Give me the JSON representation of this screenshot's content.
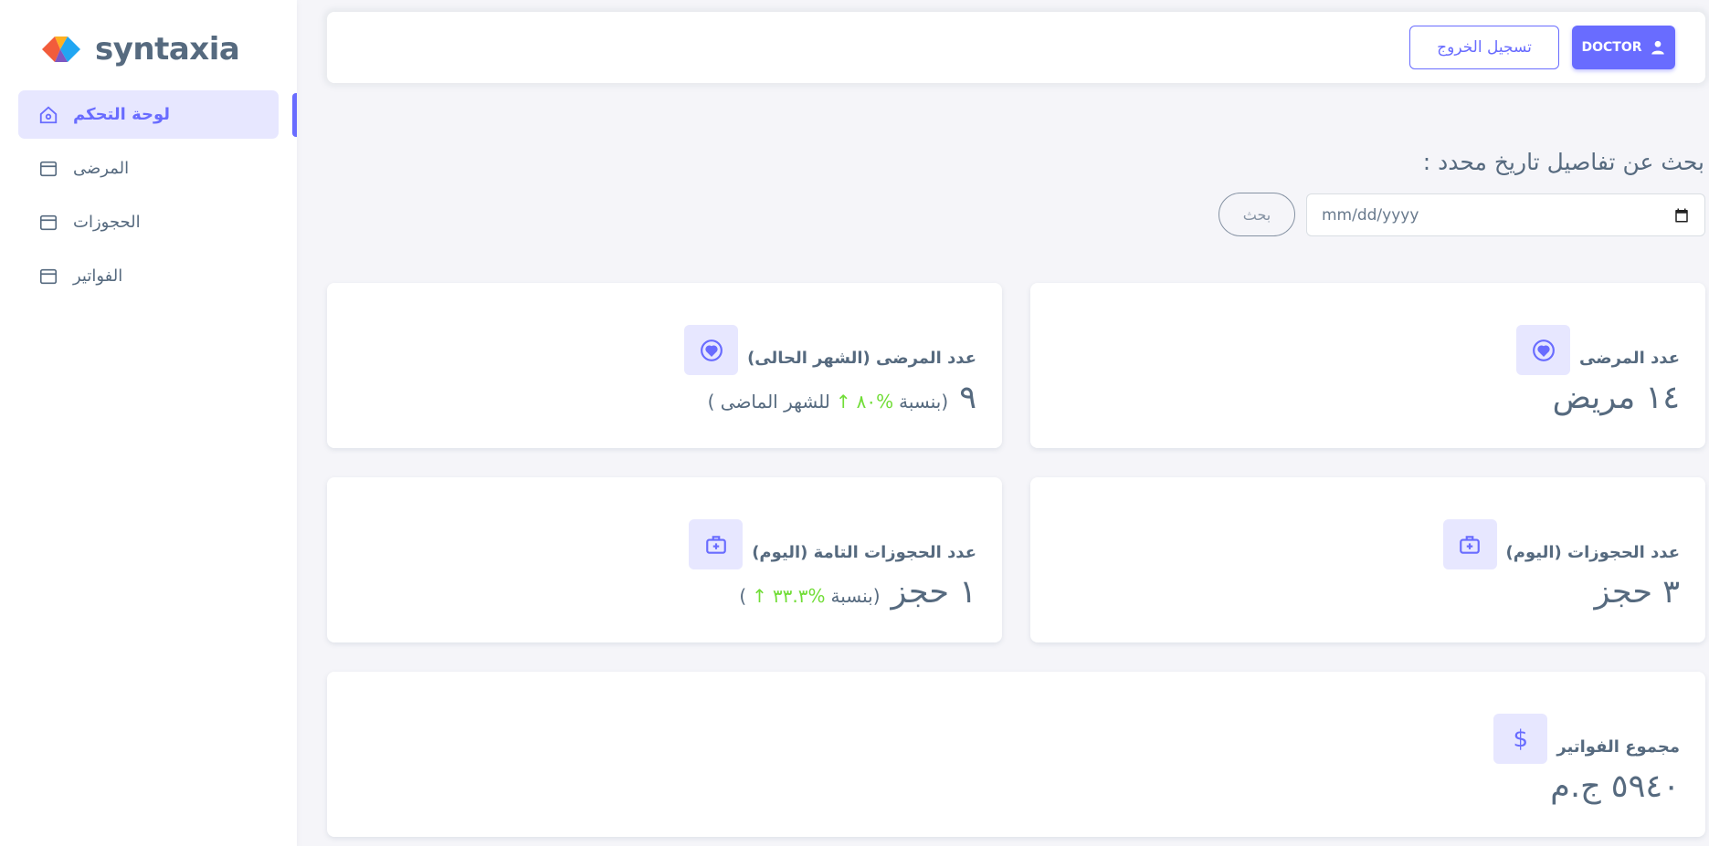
{
  "sidebar": {
    "brand": "syntaxia",
    "items": [
      {
        "label": "لوحة التحكم",
        "icon": "home-icon",
        "active": true
      },
      {
        "label": "المرضى",
        "icon": "layout-icon",
        "active": false
      },
      {
        "label": "الحجوزات",
        "icon": "layout-icon",
        "active": false
      },
      {
        "label": "الفواتير",
        "icon": "layout-icon",
        "active": false
      }
    ]
  },
  "navbar": {
    "role_button": "DOCTOR",
    "logout_button": "تسجيل الخروج"
  },
  "search": {
    "title": "بحث عن تفاصيل تاريخ محدد :",
    "date_placeholder": "mm/dd/yyyy",
    "button": "بحث"
  },
  "cards": {
    "patients_total": {
      "label": "عدد المرضى",
      "value": "١٤ مريض",
      "icon": "heart-icon"
    },
    "patients_month": {
      "label": "عدد المرضى (الشهر الحالى)",
      "value": "٩",
      "pre": "(بنسبة",
      "percent": "%٨٠",
      "arrow": "↑",
      "post": "للشهر الماضى )",
      "icon": "heart-icon"
    },
    "bookings_today": {
      "label": "عدد الحجوزات (اليوم)",
      "value": "٣ حجز",
      "icon": "medical-kit-icon"
    },
    "bookings_done": {
      "label": "عدد الحجوزات التامة (اليوم)",
      "value": "١ حجز",
      "pre": "(بنسبة",
      "percent": "%٣٣.٣",
      "arrow": "↑",
      "post": ")",
      "icon": "medical-kit-icon"
    },
    "invoices_total": {
      "label": "مجموع الفواتير",
      "value": "٥٩٤٠ ج.م",
      "icon": "dollar-icon"
    }
  },
  "colors": {
    "primary": "#696cff",
    "primary_light": "#e7e7ff",
    "success": "#71dd37",
    "text": "#566a7f",
    "background": "#f5f5f9"
  }
}
